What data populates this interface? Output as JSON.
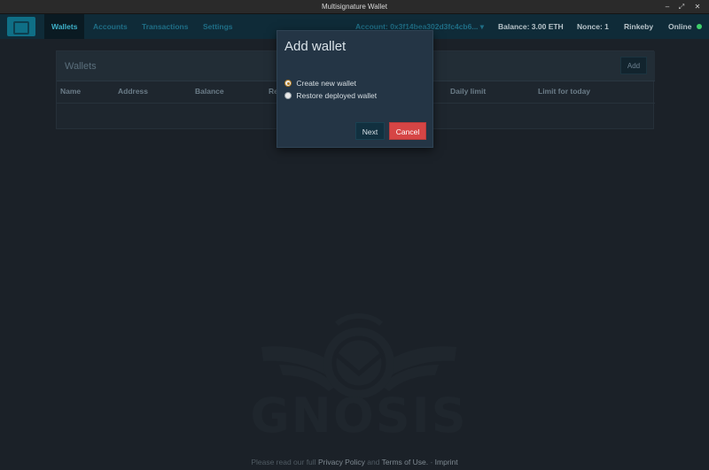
{
  "window": {
    "title": "Multisignature Wallet",
    "controls": {
      "minimize": "‒",
      "maximize": "⤢",
      "close": "✕"
    }
  },
  "nav": {
    "items": [
      "Wallets",
      "Accounts",
      "Transactions",
      "Settings"
    ],
    "account": "Account: 0x3f14bea302d3fc4cb6... ▾",
    "balance": "Balance: 3.00 ETH",
    "nonce": "Nonce: 1",
    "network": "Rinkeby",
    "status": "Online",
    "status_color": "#3ecf6a"
  },
  "panel": {
    "title": "Wallets",
    "add_label": "Add",
    "columns": [
      "Name",
      "Address",
      "Balance",
      "Re",
      "Daily limit",
      "Limit for today"
    ]
  },
  "watermark": {
    "text": "GNOSIS"
  },
  "footer": {
    "prefix": "Please read our full",
    "privacy": "Privacy Policy",
    "and": "and",
    "terms": "Terms of Use.",
    "dash": "-",
    "imprint": "Imprint"
  },
  "modal": {
    "title": "Add wallet",
    "options": [
      "Create new wallet",
      "Restore deployed wallet"
    ],
    "selected_index": 0,
    "next_label": "Next",
    "cancel_label": "Cancel"
  },
  "colors": {
    "accent": "#1f6e86",
    "cancel": "#d64545",
    "nav_bg": "#0f2b38"
  }
}
